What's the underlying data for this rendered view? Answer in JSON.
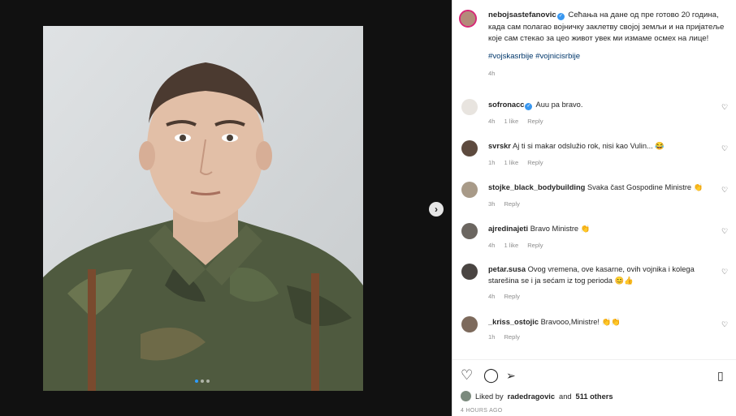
{
  "post": {
    "username": "nebojsastefanovic",
    "caption": "Сећања на дане од пре готово 20 година, када сам полагао војничку заклетву својој земљи и на пријатеље које сам стекао за цео живот увек ми измаме осмех на лице!",
    "hashtags": "#vojskasrbije #vojnicisrbije",
    "time": "4h"
  },
  "comments": [
    {
      "user": "sofronacc",
      "verified": true,
      "text": "Auu pa bravo.",
      "time": "4h",
      "likes": "1 like",
      "reply": "Reply"
    },
    {
      "user": "svrskr",
      "verified": false,
      "text": "Aj ti si makar odslužio rok, nisi kao Vulin... 😂",
      "time": "1h",
      "likes": "1 like",
      "reply": "Reply"
    },
    {
      "user": "stojke_black_bodybuilding",
      "verified": false,
      "text": "Svaka čast Gospodine Ministre 👏",
      "time": "3h",
      "likes": "",
      "reply": "Reply"
    },
    {
      "user": "ajredinajeti",
      "verified": false,
      "text": "Bravo Ministre 👏",
      "time": "4h",
      "likes": "1 like",
      "reply": "Reply"
    },
    {
      "user": "petar.susa",
      "verified": false,
      "text": "Ovog vremena, ove kasarne, ovih vojnika i kolega starešina se i ja sećam iz tog perioda 😊👍",
      "time": "4h",
      "likes": "",
      "reply": "Reply"
    },
    {
      "user": "_kriss_ostojic",
      "verified": false,
      "text": "Bravooo,Ministre! 👏👏",
      "time": "1h",
      "likes": "",
      "reply": "Reply"
    }
  ],
  "likes": {
    "prefix": "Liked by",
    "user": "radedragovic",
    "and": "and",
    "others": "511 others"
  },
  "time_ago": "4 HOURS AGO",
  "icons": {
    "next": "chevron-right-icon",
    "like": "heart-icon",
    "comment": "comment-icon",
    "share": "share-icon",
    "save": "bookmark-icon"
  },
  "colors": {
    "verified": "#3897f0",
    "hashtag": "#00376b",
    "carousel_active": "#2d9cff"
  }
}
